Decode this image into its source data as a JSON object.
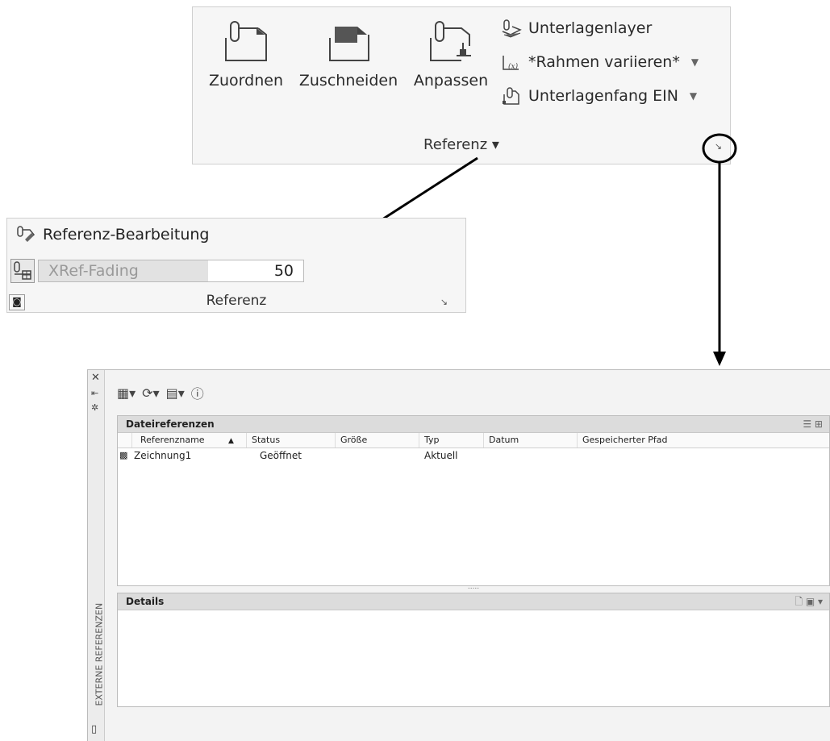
{
  "ribbon": {
    "buttons": [
      {
        "label": "Zuordnen",
        "icon": "paperclip-page-icon"
      },
      {
        "label": "Zuschneiden",
        "icon": "clip-frame-icon"
      },
      {
        "label": "Anpassen",
        "icon": "adjust-reference-icon"
      }
    ],
    "small_items": [
      {
        "label": "Unterlagenlayer",
        "icon": "underlay-layer-icon"
      },
      {
        "label": "*Rahmen variieren*",
        "icon": "frame-vary-icon"
      },
      {
        "label": "Unterlagenfang EIN",
        "icon": "underlay-snap-icon"
      }
    ],
    "panel_title": "Referenz ▾",
    "launcher": "↘"
  },
  "mini_panel": {
    "ref_edit_label": "Referenz-Bearbeitung",
    "xref_fading_label": "XRef-Fading",
    "xref_fading_value": "50",
    "xref_fading_fraction": 0.64,
    "title": "Referenz",
    "launcher": "↘"
  },
  "palette": {
    "vertical_title": "EXTERNE REFERENZEN",
    "file_refs_title": "Dateireferenzen",
    "columns": [
      "Referenzname",
      "Status",
      "Größe",
      "Typ",
      "Datum",
      "Gespeicherter Pfad"
    ],
    "rows": [
      {
        "name": "Zeichnung1",
        "status": "Geöffnet",
        "size": "",
        "type": "Aktuell",
        "date": "",
        "path": ""
      }
    ],
    "details_title": "Details",
    "splitter": "....."
  },
  "colors": {
    "panel_bg": "#f6f6f6",
    "header_bg": "#dcdcdc"
  }
}
